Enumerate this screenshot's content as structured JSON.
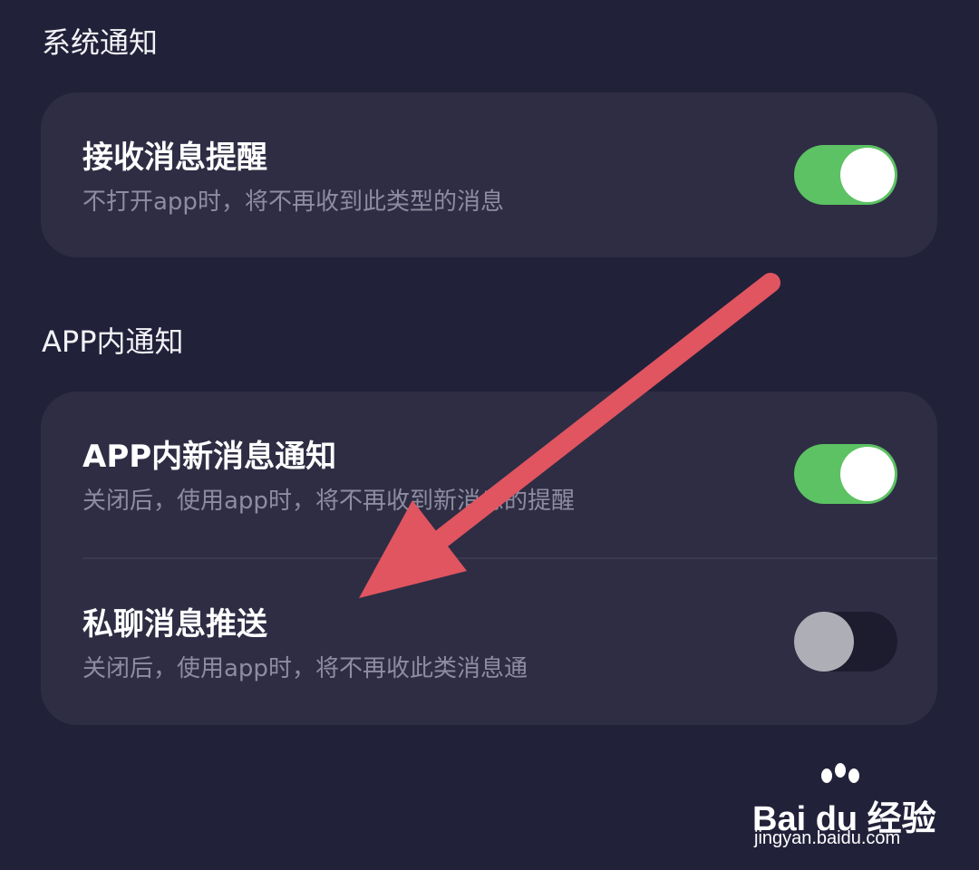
{
  "sections": {
    "system": {
      "title": "系统通知",
      "items": [
        {
          "title": "接收消息提醒",
          "subtitle": "不打开app时，将不再收到此类型的消息",
          "enabled": true
        }
      ]
    },
    "in_app": {
      "title": "APP内通知",
      "items": [
        {
          "title": "APP内新消息通知",
          "subtitle": "关闭后，使用app时，将不再收到新消息的提醒",
          "enabled": true
        },
        {
          "title": "私聊消息推送",
          "subtitle": "关闭后，使用app时，将不再收此类消息通",
          "enabled": false
        }
      ]
    }
  },
  "colors": {
    "background": "#22213a",
    "card": "#2e2d44",
    "toggle_on": "#5cc263",
    "annotation_arrow": "#e05560"
  },
  "watermark": {
    "logo_text": "Bai du 经验",
    "url": "jingyan.baidu.com"
  }
}
